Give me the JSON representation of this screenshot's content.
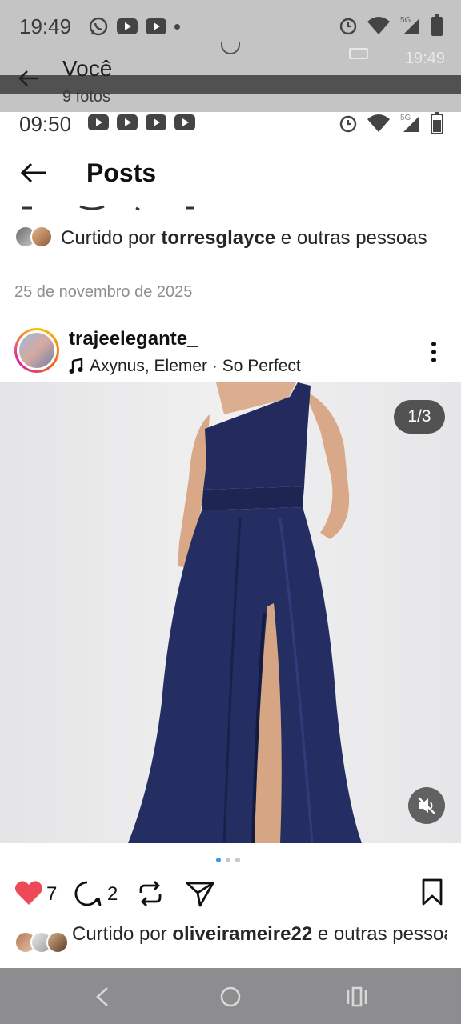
{
  "outer_status": {
    "time": "19:49"
  },
  "outer_header": {
    "title": "Você",
    "subtitle": "9 fotos",
    "timestamp": "19:49"
  },
  "inner_status": {
    "time": "09:50",
    "network": "5G"
  },
  "ig_header": {
    "title": "Posts"
  },
  "prev_post": {
    "liked_prefix": "Curtido por ",
    "liked_user": "torresglayce",
    "liked_suffix": " e outras pessoas",
    "date": "25 de novembro de 2025"
  },
  "post": {
    "username": "trajeelegante_",
    "music": "Axynus, Elemer · So Perfect",
    "counter": "1/3",
    "likes": "7",
    "comments": "2",
    "liked_prefix": "Curtido por ",
    "liked_user": "oliveirameire22",
    "liked_suffix": " e outras pessoas",
    "carousel_index": 1,
    "carousel_total": 3
  },
  "colors": {
    "like_red": "#ed4956",
    "dress_navy": "#232b5e",
    "carousel_blue": "#3897f0"
  },
  "icons": [
    "back-arrow-icon",
    "whatsapp-icon",
    "youtube-icon",
    "alarm-icon",
    "wifi-icon",
    "signal-icon",
    "battery-icon",
    "music-note-icon",
    "more-vertical-icon",
    "mute-icon",
    "heart-icon",
    "comment-icon",
    "repost-icon",
    "share-icon",
    "bookmark-icon",
    "nav-back-icon",
    "nav-home-icon",
    "nav-recents-icon"
  ]
}
